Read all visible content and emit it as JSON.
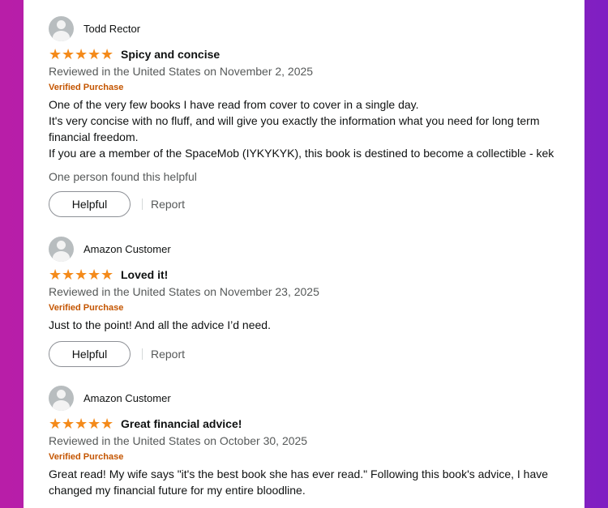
{
  "reviews": [
    {
      "name": "Todd Rector",
      "rating": 5,
      "title": "Spicy and concise",
      "date": "Reviewed in the United States on November 2, 2025",
      "badge": "Verified Purchase",
      "body": [
        "One of the very few books I have read from cover to cover in a single day.",
        "It's very concise with no fluff, and will give you exactly the information what you need for long term financial freedom.",
        "If you are a member of the SpaceMob (IYKYKYK), this book is destined to become a collectible - kek"
      ],
      "helpful_count": "One person found this helpful",
      "helpful_label": "Helpful",
      "report_label": "Report"
    },
    {
      "name": "Amazon Customer",
      "rating": 5,
      "title": "Loved it!",
      "date": "Reviewed in the United States on November 23, 2025",
      "badge": "Verified Purchase",
      "body": [
        "Just to the point! And all the advice I’d need."
      ],
      "helpful_label": "Helpful",
      "report_label": "Report"
    },
    {
      "name": "Amazon Customer",
      "rating": 5,
      "title": "Great financial advice!",
      "date": "Reviewed in the United States on October 30, 2025",
      "badge": "Verified Purchase",
      "body": [
        "Great read! My wife says \"it's the best book she has ever read.\" Following this book's advice, I have changed my financial future for my entire bloodline."
      ]
    }
  ],
  "icons": {
    "avatar": "user-avatar-icon",
    "star": "star-icon"
  },
  "colors": {
    "star": "#f48a1a",
    "verified": "#c45500",
    "background_left": "#b81ea8",
    "background_right": "#7f1fc2"
  }
}
